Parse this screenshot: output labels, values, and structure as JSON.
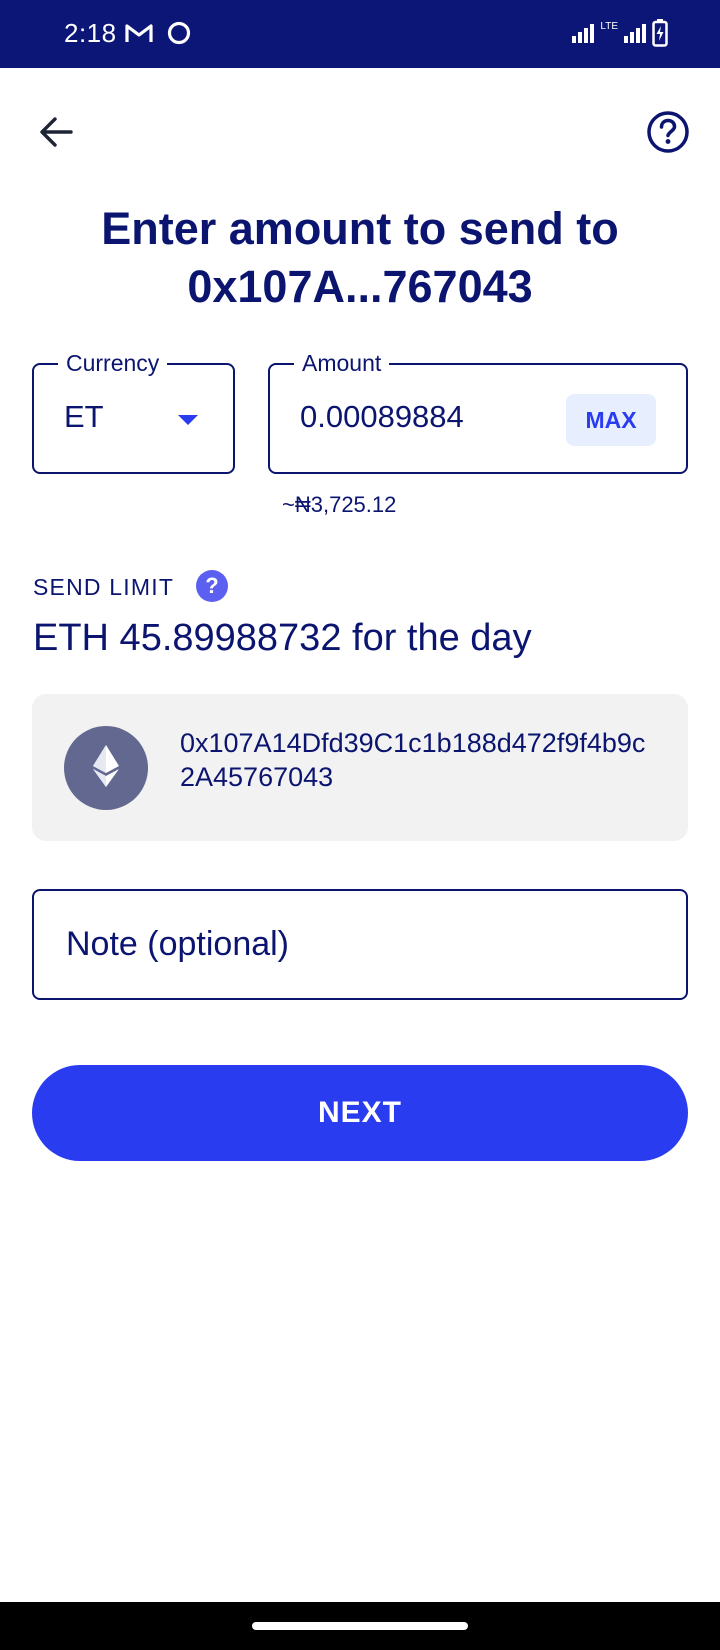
{
  "status_bar": {
    "time": "2:18",
    "left_icons": [
      "gmail-icon",
      "circle-icon"
    ],
    "right_icons": [
      "signal-icon",
      "lte-icon",
      "signal-icon",
      "battery-charging-icon"
    ],
    "network_label": "LTE"
  },
  "nav": {
    "back_icon": "arrow-left-icon",
    "help_icon": "question-circle-icon"
  },
  "title": "Enter amount to send to 0x107A...767043",
  "currency": {
    "label": "Currency",
    "value": "ET"
  },
  "amount": {
    "label": "Amount",
    "value": "0.00089884",
    "max_label": "MAX",
    "fiat_estimate": "~₦3,725.12"
  },
  "send_limit": {
    "label": "SEND LIMIT",
    "help_glyph": "?",
    "value": "ETH 45.89988732 for the day"
  },
  "recipient": {
    "icon": "ethereum-icon",
    "address": "0x107A14Dfd39C1c1b188d472f9f4b9c2A45767043"
  },
  "note": {
    "placeholder": "Note (optional)",
    "value": ""
  },
  "next_button": "NEXT",
  "colors": {
    "primary": "#2a3cf0",
    "navy": "#0b1570",
    "status_bar": "#0c1677",
    "card_bg": "#f2f2f2",
    "max_bg": "#e7efff",
    "eth_avatar": "#626890"
  }
}
